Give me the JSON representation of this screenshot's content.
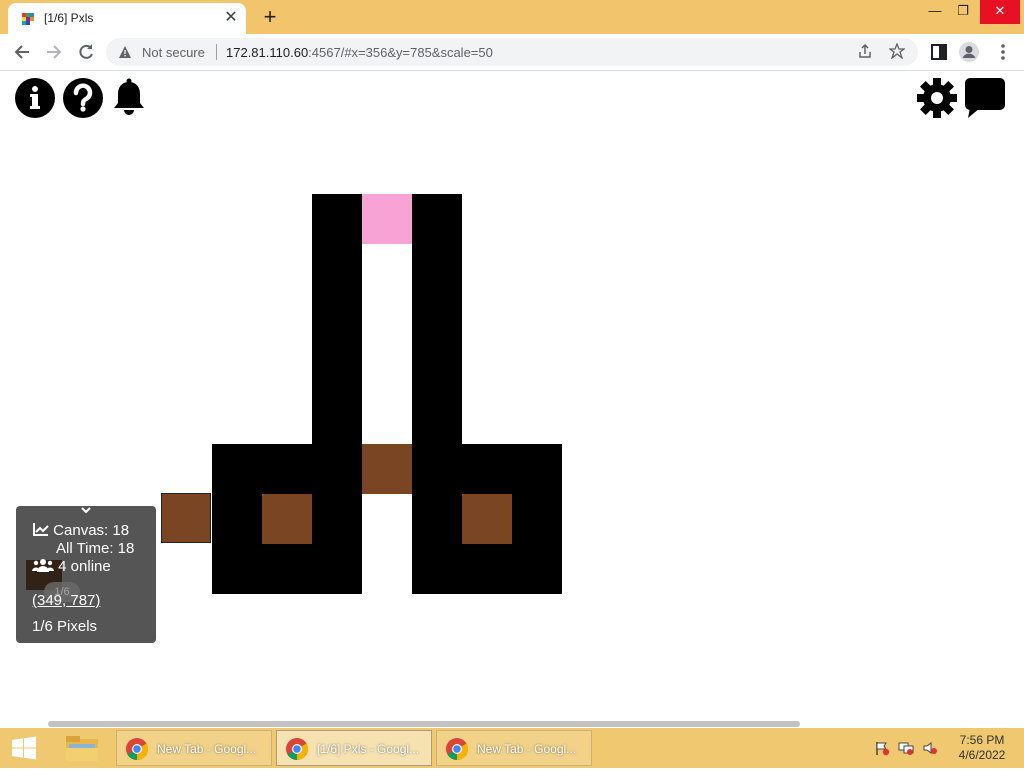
{
  "browser": {
    "tab_title": "[1/6] Pxls",
    "tab_close": "✕",
    "new_tab": "+",
    "window_controls": {
      "minimize": "—",
      "restore": "❐",
      "close": "✕"
    },
    "security_label": "Not secure",
    "url_host": "172.81.110.60",
    "url_path": ":4567/#x=356&y=785&scale=50"
  },
  "canvas_page": {
    "top_left_icons": [
      "info-icon",
      "help-icon",
      "bell-icon"
    ],
    "top_right_icons": [
      "gear-icon",
      "chat-icon"
    ],
    "pixel_colors": {
      "black": "#000000",
      "brown": "#7a4523",
      "pink": "#f7a3d6"
    },
    "stats": {
      "canvas_label": "Canvas: 18",
      "alltime_label": "All Time: 18",
      "online_label": "4 online",
      "coords": "(349, 787)",
      "pixels_label": "1/6 Pixels",
      "overlay_text": "1/6"
    },
    "palette": {
      "selected_index": 9,
      "colors": [
        "#000000",
        "#222222",
        "#555555",
        "#888888",
        "#cdcdcd",
        "#ffffff",
        "#ffd5bc",
        "#ffb783",
        "#b66d3d",
        "#77431f",
        "#fc7510",
        "#fca80e",
        "#fde111",
        "#fef06e",
        "#bfe739",
        "#67d80e",
        "#2d9e18",
        "#075c2f",
        "#217b6c",
        "#2fb6a0",
        "#7dfff0",
        "#26aafa",
        "#0c58cc",
        "#232855",
        "#8f1ec0"
      ]
    }
  },
  "taskbar": {
    "items": [
      {
        "label": "New Tab - Googl...",
        "active": false
      },
      {
        "label": "[1/6] Pxls - Googl...",
        "active": true
      },
      {
        "label": "New Tab - Googl...",
        "active": false
      }
    ],
    "time": "7:56 PM",
    "date": "4/6/2022"
  }
}
